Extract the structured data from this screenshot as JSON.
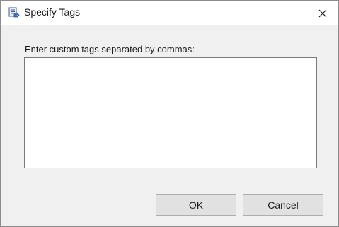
{
  "window": {
    "title": "Specify Tags",
    "app_icon": "tag-document-icon",
    "close_icon": "close-icon"
  },
  "dialog": {
    "prompt": "Enter custom tags separated by commas:",
    "tags_value": ""
  },
  "buttons": {
    "ok_label": "OK",
    "cancel_label": "Cancel"
  },
  "colors": {
    "dialog_background": "#f0f0f0",
    "titlebar_background": "#ffffff",
    "button_face": "#e1e1e1",
    "button_border": "#adadad"
  }
}
